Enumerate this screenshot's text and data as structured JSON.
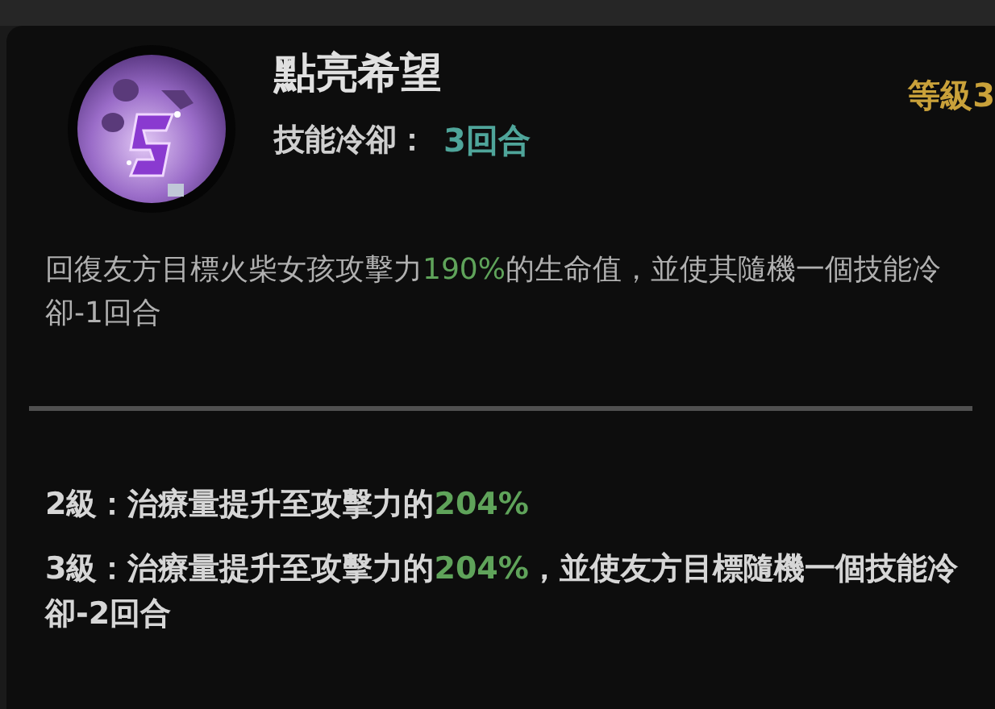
{
  "skill": {
    "name": "點亮希望",
    "level_label": "等級3",
    "cooldown_label": "技能冷卻：",
    "cooldown_value": "3回合"
  },
  "description": [
    {
      "text": "回復友方目標火柴女孩攻擊力",
      "highlight": false
    },
    {
      "text": "190%",
      "highlight": true
    },
    {
      "text": "的生命值，並使其隨機一個技能冷卻-1回合",
      "highlight": false
    }
  ],
  "upgrades": [
    [
      {
        "text": "2級：治療量提升至攻擊力的",
        "highlight": false
      },
      {
        "text": "204%",
        "highlight": true
      }
    ],
    [
      {
        "text": "3級：治療量提升至攻擊力的",
        "highlight": false
      },
      {
        "text": "204%",
        "highlight": true
      },
      {
        "text": "，並使友方目標隨機一個技能冷卻-2回合",
        "highlight": false
      }
    ]
  ]
}
